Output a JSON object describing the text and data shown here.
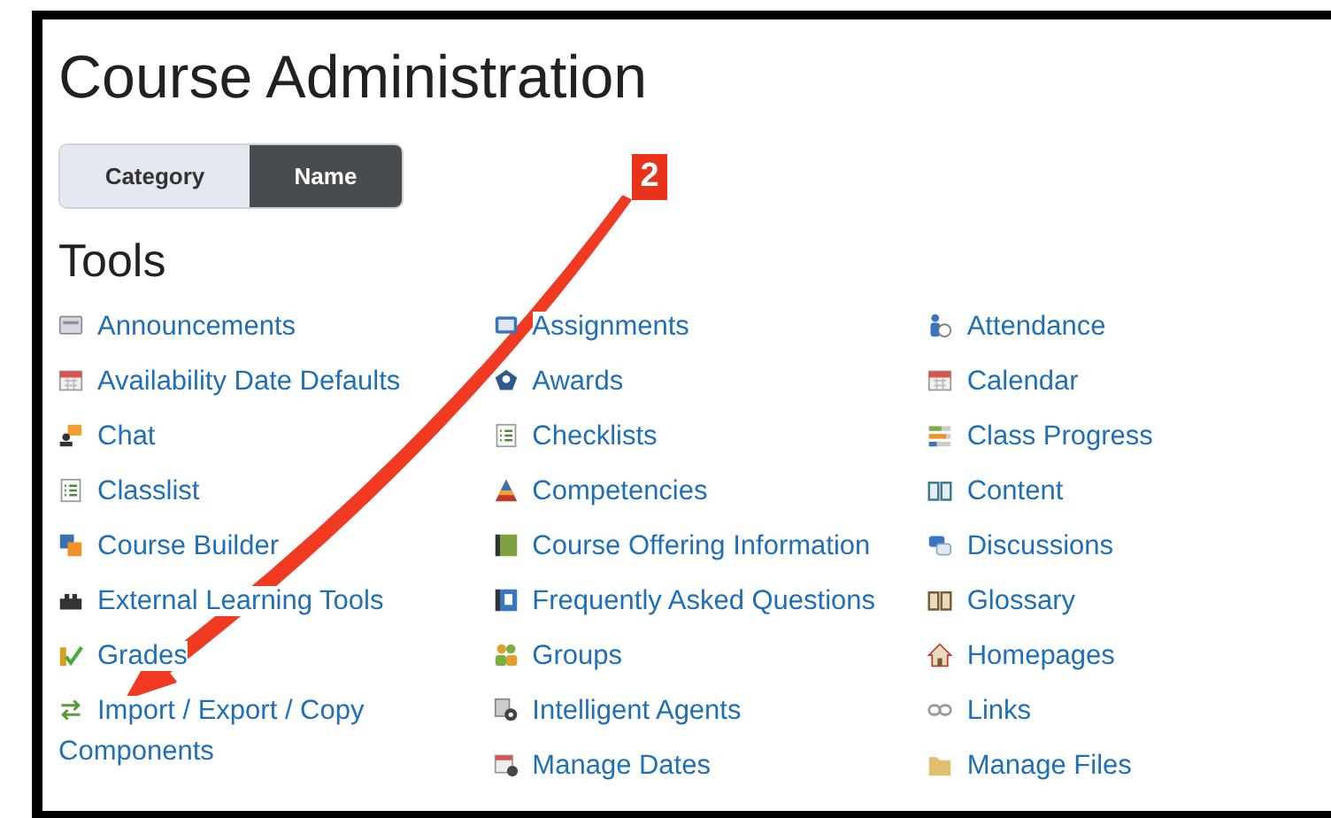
{
  "page": {
    "title": "Course Administration"
  },
  "view_toggle": [
    {
      "label": "Category",
      "selected": false
    },
    {
      "label": "Name",
      "selected": true
    }
  ],
  "section": {
    "title": "Tools"
  },
  "tool_columns": [
    {
      "items": [
        {
          "label": "Announcements"
        },
        {
          "label": "Availability Date Defaults"
        },
        {
          "label": "Chat"
        },
        {
          "label": "Classlist"
        },
        {
          "label": "Course Builder"
        },
        {
          "label": "External Learning Tools"
        },
        {
          "label": "Grades"
        },
        {
          "label": "Import / Export / Copy Components"
        }
      ]
    },
    {
      "items": [
        {
          "label": "Assignments"
        },
        {
          "label": "Awards"
        },
        {
          "label": "Checklists"
        },
        {
          "label": "Competencies"
        },
        {
          "label": "Course Offering Information"
        },
        {
          "label": "Frequently Asked Questions"
        },
        {
          "label": "Groups"
        },
        {
          "label": "Intelligent Agents"
        },
        {
          "label": "Manage Dates"
        }
      ]
    },
    {
      "items": [
        {
          "label": "Attendance"
        },
        {
          "label": "Calendar"
        },
        {
          "label": "Class Progress"
        },
        {
          "label": "Content"
        },
        {
          "label": "Discussions"
        },
        {
          "label": "Glossary"
        },
        {
          "label": "Homepages"
        },
        {
          "label": "Links"
        },
        {
          "label": "Manage Files"
        }
      ]
    }
  ],
  "annotation": {
    "label": "2"
  }
}
